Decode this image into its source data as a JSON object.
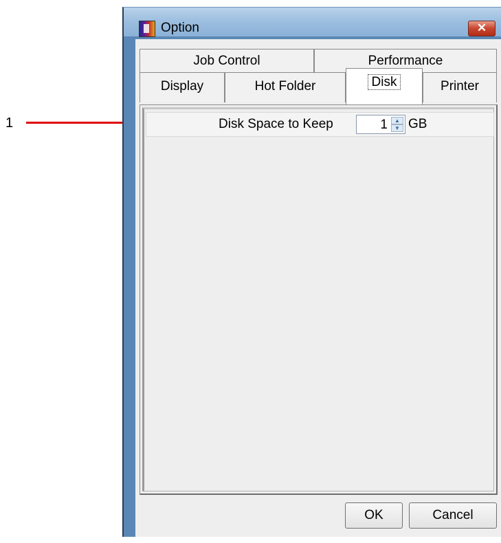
{
  "callout": {
    "number": "1"
  },
  "window": {
    "title": "Option",
    "close_icon": "close-icon"
  },
  "tabs": {
    "row1": [
      "Job Control",
      "Performance"
    ],
    "row2": [
      "Display",
      "Hot Folder",
      "Disk",
      "Printer"
    ],
    "selected": "Disk"
  },
  "disk": {
    "label": "Disk Space to Keep",
    "value": "1",
    "unit": "GB"
  },
  "buttons": {
    "ok": "OK",
    "cancel": "Cancel"
  },
  "colors": {
    "callout_line": "#e00000",
    "close_button": "#c9452e"
  }
}
